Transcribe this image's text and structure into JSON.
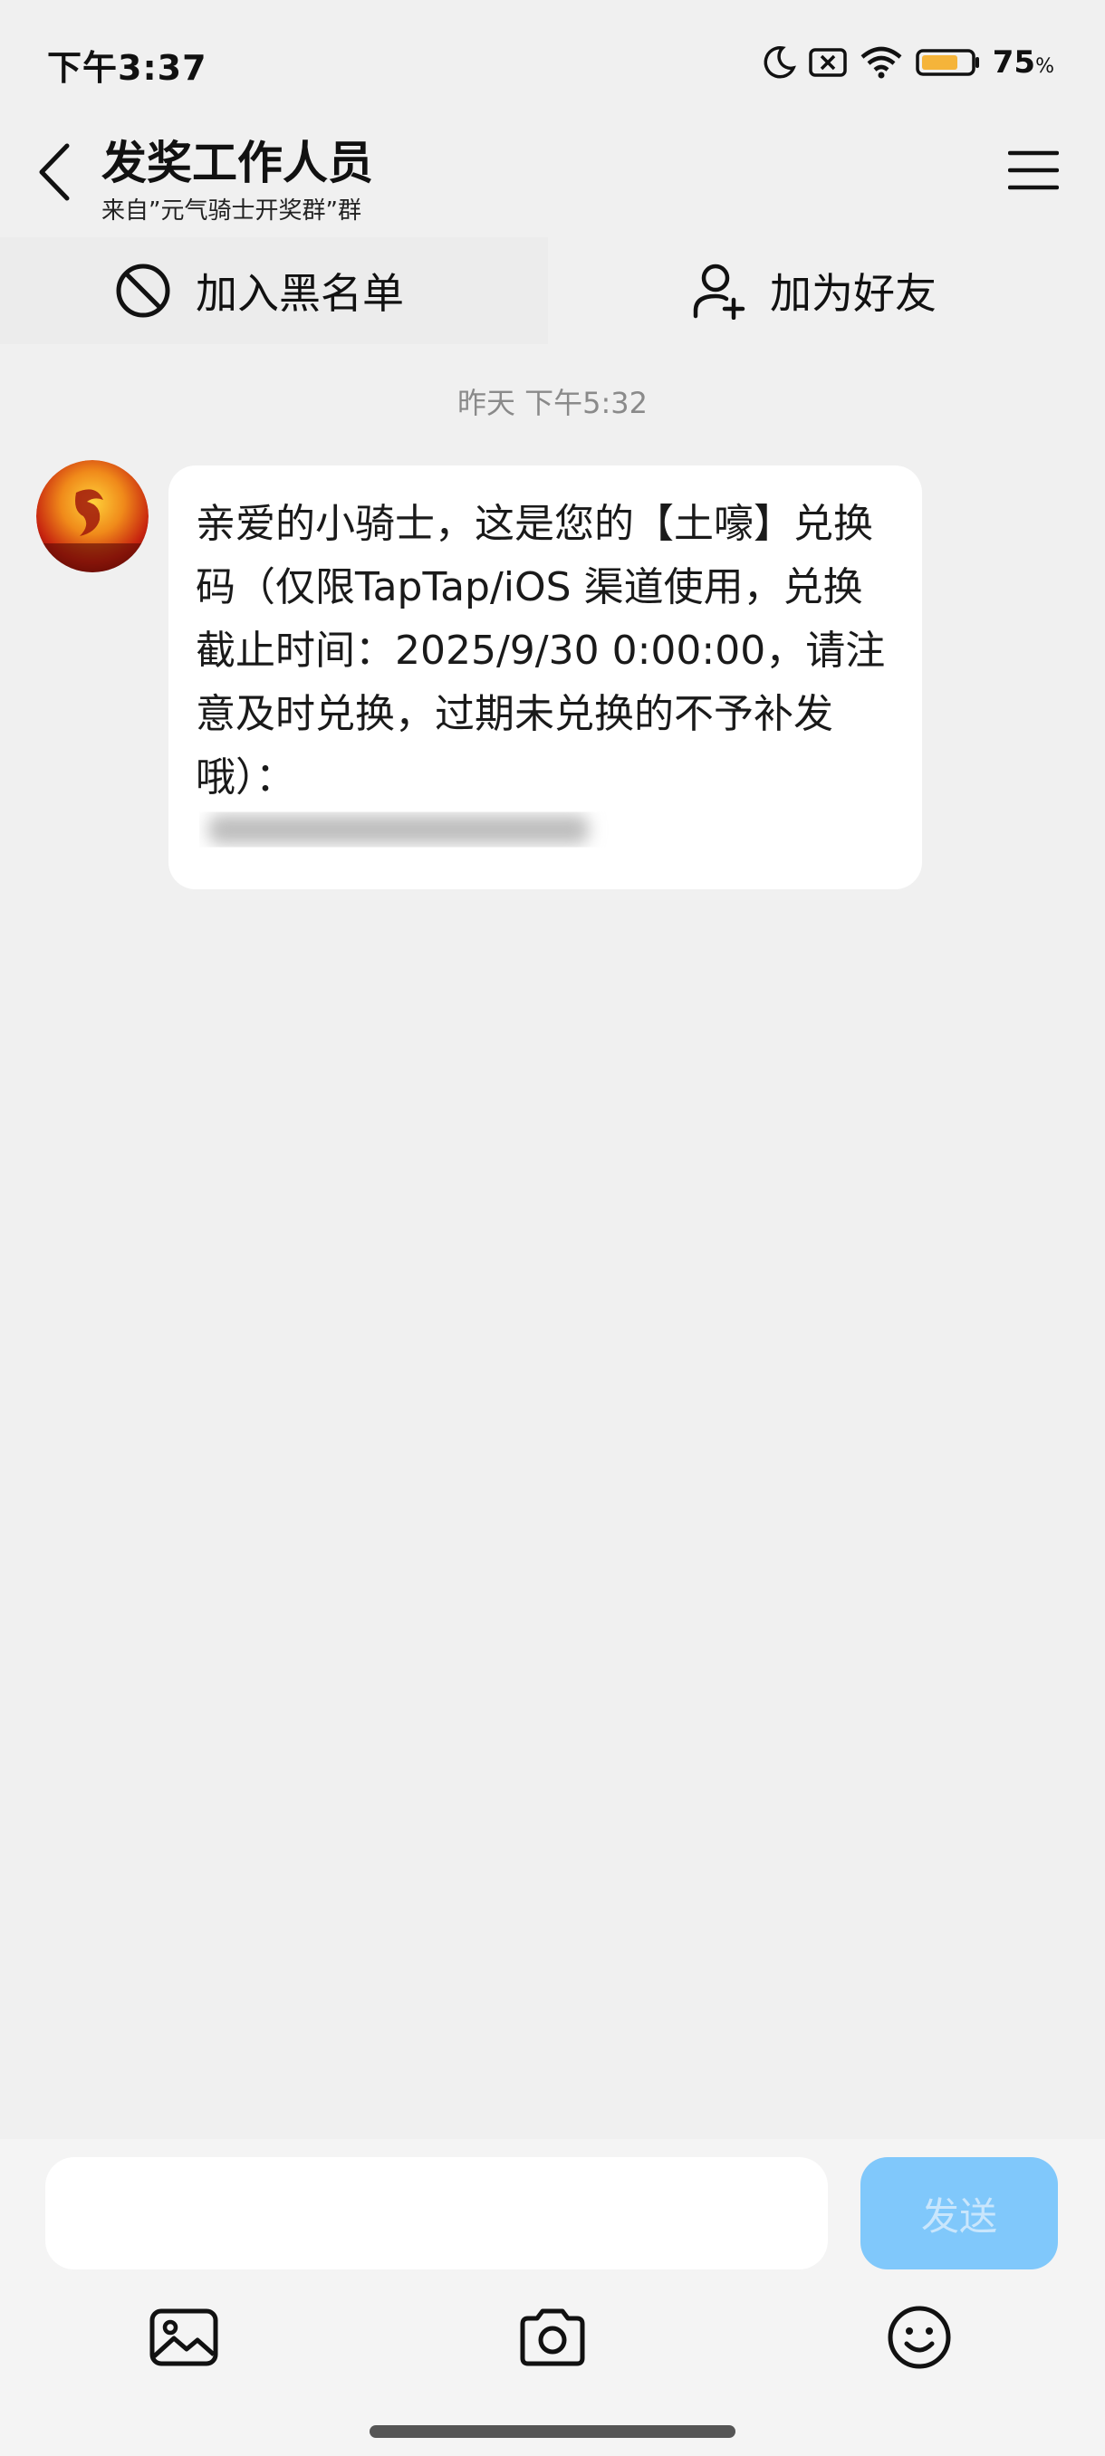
{
  "status_bar": {
    "time": "下午3:37",
    "battery_percent": "75",
    "battery_unit": "%",
    "battery_level": 0.75
  },
  "header": {
    "title": "发奖工作人员",
    "subtitle": "来自”元气骑士开奖群”群"
  },
  "actions": {
    "block_label": "加入黑名单",
    "add_friend_label": "加为好友"
  },
  "chat": {
    "timestamp": "昨天 下午5:32",
    "message": "亲爱的小骑士，这是您的【土嚎】兑换码（仅限TapTap/iOS 渠道使用，兑换截止时间：2025/9/30 0:00:00，请注意及时兑换，过期未兑换的不予补发哦）："
  },
  "input": {
    "placeholder": "",
    "send_label": "发送"
  },
  "colors": {
    "background": "#f0f0f0",
    "send_button": "#80c8fb",
    "battery_fill": "#f5b43a"
  }
}
